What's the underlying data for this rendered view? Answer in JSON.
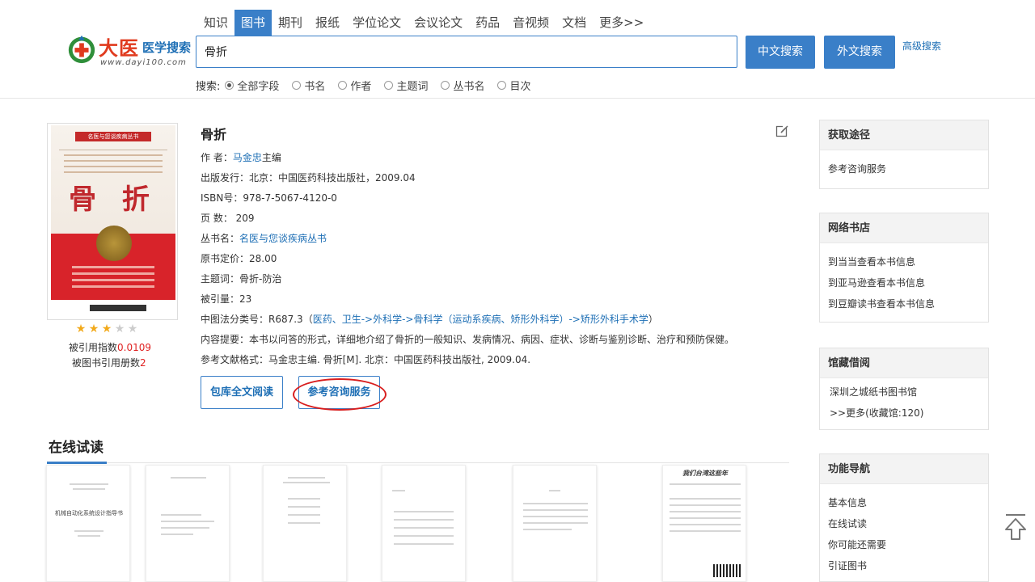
{
  "header": {
    "logo": {
      "brand": "大医",
      "brand_sub": "医学搜索",
      "url": "www.dayi100.com"
    },
    "tabs": [
      "知识",
      "图书",
      "期刊",
      "报纸",
      "学位论文",
      "会议论文",
      "药品",
      "音视频",
      "文档",
      "更多>>"
    ],
    "active_tab": "图书",
    "search_value": "骨折",
    "btn_chinese": "中文搜索",
    "btn_foreign": "外文搜索",
    "advanced": "高级搜索",
    "field_label": "搜索:",
    "fields": [
      "全部字段",
      "书名",
      "作者",
      "主题词",
      "丛书名",
      "目次"
    ],
    "selected_field": "全部字段"
  },
  "book": {
    "cover": {
      "series_tag": "名医与您谈疾病丛书",
      "title_text": "骨 折"
    },
    "rating": {
      "stars": 3,
      "max": 5
    },
    "cited_index_label": "被引用指数",
    "cited_index_value": "0.0109",
    "cited_books_label": "被图书引用册数",
    "cited_books_value": "2",
    "title": "骨折",
    "author_label": "作 者：",
    "author_name": "马金忠",
    "author_suffix": "主编",
    "publish": "出版发行：北京：中国医药科技出版社，2009.04",
    "isbn": "ISBN号：978-7-5067-4120-0",
    "pages": "页 数： 209",
    "series_label": "丛书名：",
    "series_name": "名医与您谈疾病丛书",
    "price": "原书定价：28.00",
    "subject": "主题词：骨折-防治",
    "cited": "被引量：23",
    "clc_prefix": "中图法分类号：R687.3（",
    "clc_path": "医药、卫生->外科学->骨科学（运动系疾病、矫形外科学）->矫形外科手术学",
    "clc_suffix": "）",
    "summary": "内容提要：本书以问答的形式，详细地介绍了骨折的一般知识、发病情况、病因、症状、诊断与鉴别诊断、治疗和预防保健。",
    "citation": "参考文献格式：马金忠主编. 骨折[M]. 北京：中国医药科技出版社, 2009.04.",
    "btn_read": "包库全文阅读",
    "btn_consult": "参考咨询服务"
  },
  "online": {
    "title": "在线试读",
    "page1_title": "机械自动化系统设计指导书",
    "page6_title": "我们台湾这些年"
  },
  "sidebar": {
    "access": {
      "title": "获取途径",
      "items": [
        "参考咨询服务"
      ]
    },
    "stores": {
      "title": "网络书店",
      "items": [
        "到当当查看本书信息",
        "到亚马逊查看本书信息",
        "到豆瓣读书查看本书信息"
      ]
    },
    "library": {
      "title": "馆藏借阅",
      "items": [
        "深圳之城纸书图书馆",
        ">>更多(收藏馆:120)"
      ]
    },
    "nav": {
      "title": "功能导航",
      "items": [
        "基本信息",
        "在线试读",
        "你可能还需要",
        "引证图书"
      ]
    }
  },
  "colors": {
    "accent": "#3a7fc8",
    "link": "#1e6fb5",
    "highlight": "#d81e1e"
  }
}
